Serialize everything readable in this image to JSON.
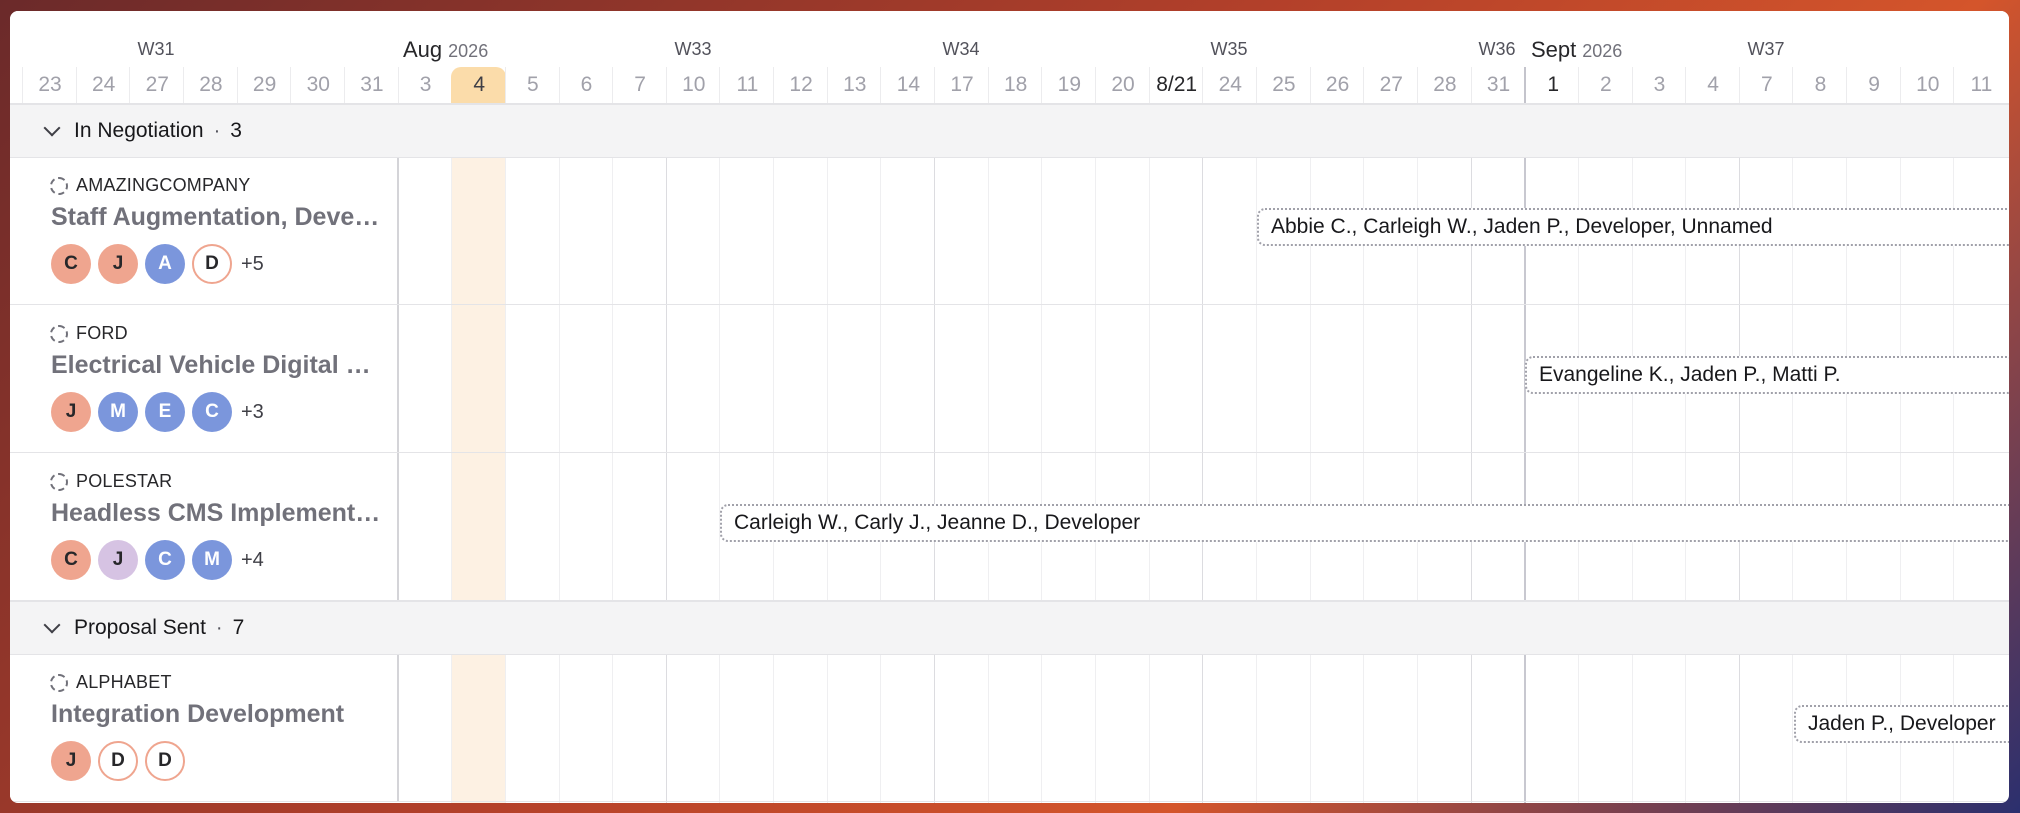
{
  "timeline": {
    "weeks": [
      "W31",
      "W33",
      "W34",
      "W35",
      "W36",
      "W37"
    ],
    "months": [
      {
        "name": "Aug",
        "year": "2026"
      },
      {
        "name": "Sept",
        "year": "2026"
      }
    ],
    "days": [
      "23",
      "24",
      "27",
      "28",
      "29",
      "30",
      "31",
      "3",
      "4",
      "5",
      "6",
      "7",
      "10",
      "11",
      "12",
      "13",
      "14",
      "17",
      "18",
      "19",
      "20",
      "8/21",
      "24",
      "25",
      "26",
      "27",
      "28",
      "31",
      "1",
      "2",
      "3",
      "4",
      "7",
      "8",
      "9",
      "10",
      "11"
    ],
    "today_label": "4"
  },
  "groups": [
    {
      "title": "In Negotiation",
      "count": "3",
      "rows": [
        {
          "client": "AMAZINGCOMPANY",
          "project": "Staff Augmentation, Development & Design",
          "avatars": [
            {
              "l": "C",
              "c": "salmon"
            },
            {
              "l": "J",
              "c": "salmon"
            },
            {
              "l": "A",
              "c": "blue"
            },
            {
              "l": "D",
              "c": "outline"
            }
          ],
          "more": "+5",
          "bar": "Abbie C., Carleigh W., Jaden P., Developer, Unnamed"
        },
        {
          "client": "FORD",
          "project": "Electrical Vehicle Digital Platform",
          "avatars": [
            {
              "l": "J",
              "c": "salmon"
            },
            {
              "l": "M",
              "c": "blue"
            },
            {
              "l": "E",
              "c": "blue"
            },
            {
              "l": "C",
              "c": "blue"
            }
          ],
          "more": "+3",
          "bar": "Evangeline K., Jaden P., Matti P."
        },
        {
          "client": "POLESTAR",
          "project": "Headless CMS Implementation",
          "avatars": [
            {
              "l": "C",
              "c": "salmon"
            },
            {
              "l": "J",
              "c": "lilac"
            },
            {
              "l": "C",
              "c": "blue"
            },
            {
              "l": "M",
              "c": "blue"
            }
          ],
          "more": "+4",
          "bar": "Carleigh W., Carly J., Jeanne D., Developer"
        }
      ]
    },
    {
      "title": "Proposal Sent",
      "count": "7",
      "rows": [
        {
          "client": "ALPHABET",
          "project": "Integration Development",
          "avatars": [
            {
              "l": "J",
              "c": "salmon"
            },
            {
              "l": "D",
              "c": "outline"
            },
            {
              "l": "D",
              "c": "outline"
            }
          ],
          "more": "",
          "bar": "Jaden P., Developer"
        }
      ]
    }
  ]
}
